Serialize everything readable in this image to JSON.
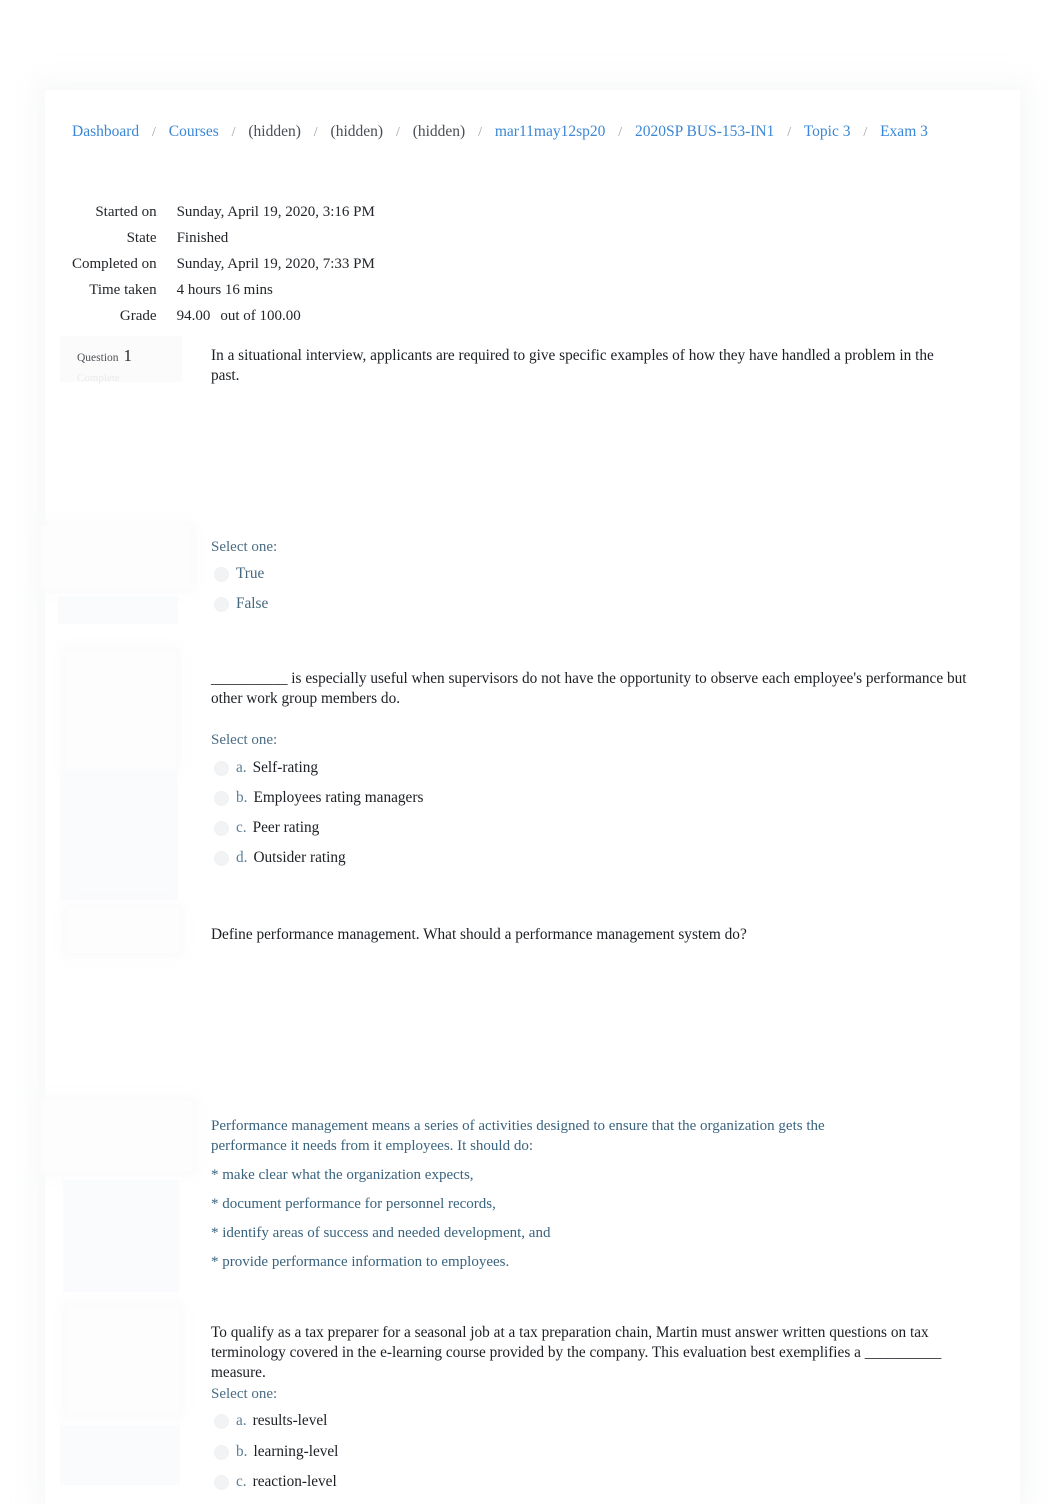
{
  "breadcrumb": {
    "items": [
      {
        "label": "Dashboard",
        "link": true
      },
      {
        "label": "Courses",
        "link": true
      },
      {
        "label": "(hidden)",
        "link": false
      },
      {
        "label": "(hidden)",
        "link": false
      },
      {
        "label": "(hidden)",
        "link": false
      },
      {
        "label": "mar11may12sp20",
        "link": true
      },
      {
        "label": "2020SP BUS-153-IN1",
        "link": true
      },
      {
        "label": "Topic 3",
        "link": true
      },
      {
        "label": "Exam 3",
        "link": true
      }
    ],
    "separator": "/"
  },
  "summary": {
    "rows": [
      {
        "label": "Started on",
        "value": "Sunday, April 19, 2020, 3:16 PM"
      },
      {
        "label": "State",
        "value": "Finished"
      },
      {
        "label": "Completed on",
        "value": "Sunday, April 19, 2020, 7:33 PM"
      },
      {
        "label": "Time taken",
        "value": "4 hours 16 mins"
      }
    ],
    "grade": {
      "label": "Grade",
      "score": "94.00",
      "out_of": "out of 100.00"
    }
  },
  "question_info": {
    "question_word": "Question",
    "number": "1",
    "sub_label": "Complete"
  },
  "questions": [
    {
      "id": "q1",
      "type": "truefalse",
      "text": "In a situational interview, applicants are required to give specific examples of how they have handled a problem in the past.",
      "select_prompt": "Select one:",
      "options": [
        {
          "letter": "",
          "label": "True"
        },
        {
          "letter": "",
          "label": "False"
        }
      ]
    },
    {
      "id": "q2",
      "type": "multichoice",
      "text": "__________ is especially useful when supervisors do not have the opportunity to observe each employee's performance but other work group members do.",
      "select_prompt": "Select one:",
      "options": [
        {
          "letter": "a.",
          "label": "Self-rating"
        },
        {
          "letter": "b.",
          "label": "Employees rating managers"
        },
        {
          "letter": "c.",
          "label": "Peer rating"
        },
        {
          "letter": "d.",
          "label": "Outsider rating"
        }
      ]
    },
    {
      "id": "q3",
      "type": "essay",
      "text": "Define performance management. What should a performance management system do?",
      "answer_paragraphs": [
        "Performance management means a series of activities designed to ensure that the organization gets the performance it needs from it employees. It should do:",
        "* make clear what the organization expects,",
        "* document performance for personnel records,",
        "* identify areas of success and needed development, and",
        "* provide performance information to employees."
      ]
    },
    {
      "id": "q4",
      "type": "multichoice",
      "text": "To qualify as a tax preparer for a seasonal job at a tax preparation chain, Martin must answer written questions on tax terminology covered in the e-learning course provided by the company. This evaluation best exemplifies a __________ measure.",
      "select_prompt": "Select one:",
      "options": [
        {
          "letter": "a.",
          "label": "results-level"
        },
        {
          "letter": "b.",
          "label": "learning-level"
        },
        {
          "letter": "c.",
          "label": "reaction-level"
        }
      ]
    }
  ],
  "colors": {
    "link": "#3a87d6",
    "answer_text": "#45687f",
    "essay_text": "#39647f",
    "body_text": "#1b1f23"
  }
}
